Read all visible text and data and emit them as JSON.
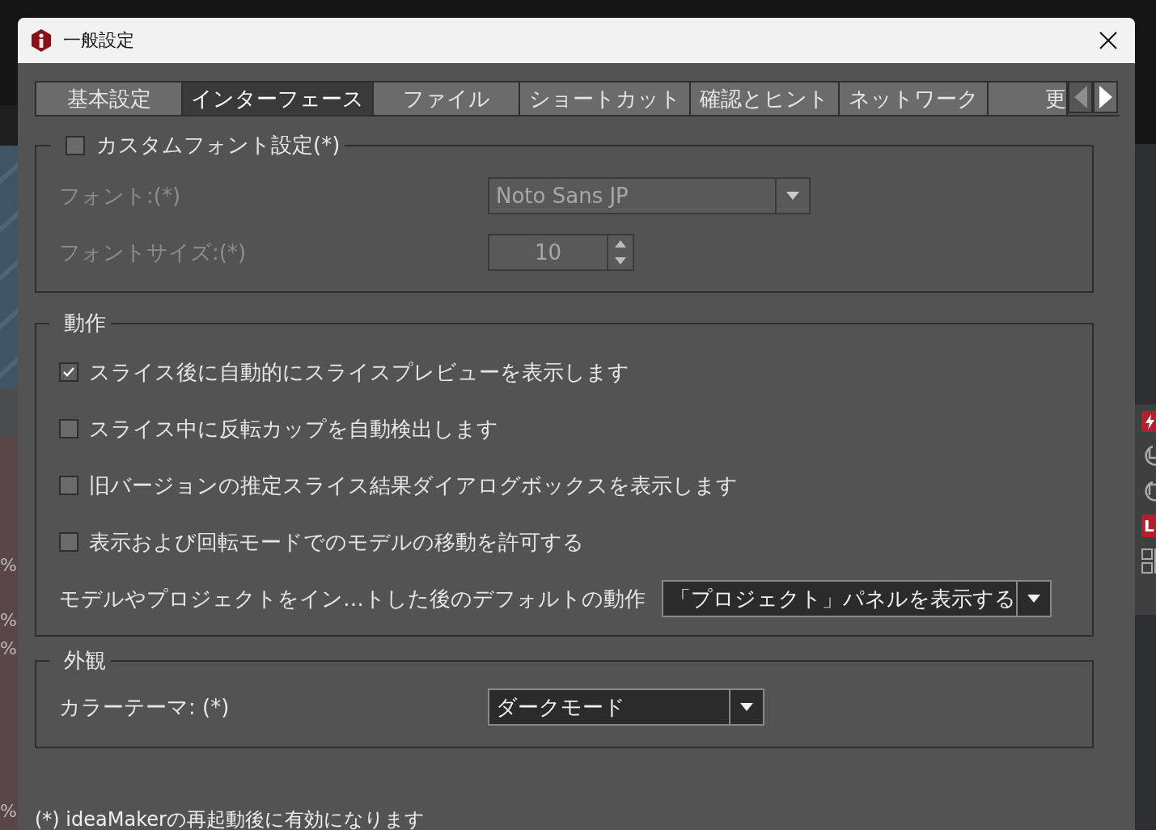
{
  "background_app": {
    "side_labels": [
      "%",
      "%",
      "%",
      "%"
    ],
    "badge": "L"
  },
  "dialog": {
    "title": "一般設定",
    "tabs": [
      {
        "label": "基本設定",
        "selected": false
      },
      {
        "label": "インターフェース",
        "selected": true
      },
      {
        "label": "ファイル",
        "selected": false
      },
      {
        "label": "ショートカット",
        "selected": false
      },
      {
        "label": "確認とヒント",
        "selected": false
      },
      {
        "label": "ネットワーク",
        "selected": false
      },
      {
        "label": "更",
        "selected": false
      }
    ],
    "tab_scroll": [
      {
        "kind": "left",
        "disabled": true
      },
      {
        "kind": "right",
        "disabled": false
      }
    ],
    "font_group": {
      "title": "カスタムフォント設定(*)",
      "checked": false,
      "font_label": "フォント:(*)",
      "font_value": "Noto Sans JP",
      "size_label": "フォントサイズ:(*)",
      "size_value": "10"
    },
    "behavior_group": {
      "title": "動作",
      "options": [
        {
          "label": "スライス後に自動的にスライスプレビューを表示します",
          "checked": true
        },
        {
          "label": "スライス中に反転カップを自動検出します",
          "checked": false
        },
        {
          "label": "旧バージョンの推定スライス結果ダイアログボックスを表示します",
          "checked": false
        },
        {
          "label": "表示および回転モードでのモデルの移動を許可する",
          "checked": false
        }
      ],
      "default_action": {
        "label": "モデルやプロジェクトをイン…トした後のデフォルトの動作",
        "value": "「プロジェクト」パネルを表示する"
      }
    },
    "appearance_group": {
      "title": "外観",
      "theme": {
        "label": "カラーテーマ: (*)",
        "value": "ダークモード"
      }
    },
    "footnote": "(*) ideaMakerの再起動後に有効になります"
  }
}
